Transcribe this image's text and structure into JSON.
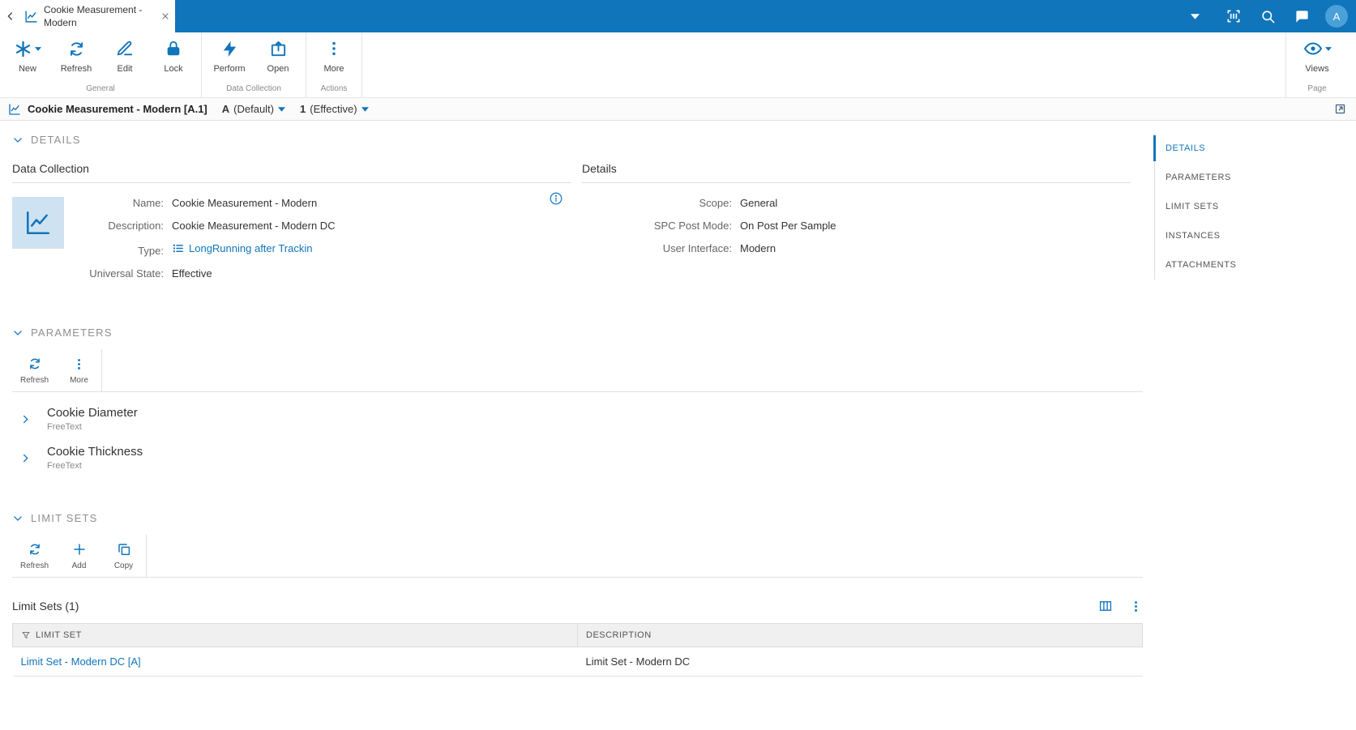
{
  "colors": {
    "accent": "#1075bb",
    "topbar": "#1075bb"
  },
  "topbar": {
    "tab_title": "Cookie Measurement - Modern",
    "avatar": "A"
  },
  "ribbon": {
    "groups": [
      {
        "label": "General",
        "buttons": [
          {
            "label": "New"
          },
          {
            "label": "Refresh"
          },
          {
            "label": "Edit"
          },
          {
            "label": "Lock"
          }
        ]
      },
      {
        "label": "Data Collection",
        "buttons": [
          {
            "label": "Perform"
          },
          {
            "label": "Open"
          }
        ]
      },
      {
        "label": "Actions",
        "buttons": [
          {
            "label": "More"
          }
        ]
      },
      {
        "label": "Page",
        "buttons": [
          {
            "label": "Views"
          }
        ]
      }
    ]
  },
  "breadcrumb": {
    "title": "Cookie Measurement - Modern [A.1]",
    "version": "A",
    "version_label": "(Default)",
    "revision": "1",
    "revision_label": "(Effective)"
  },
  "details": {
    "heading": "DETAILS",
    "data_collection": {
      "title": "Data Collection",
      "fields": [
        {
          "label": "Name:",
          "value": "Cookie Measurement - Modern"
        },
        {
          "label": "Description:",
          "value": "Cookie Measurement - Modern DC"
        },
        {
          "label": "Type:",
          "value": "LongRunning after Trackin"
        },
        {
          "label": "Universal State:",
          "value": "Effective"
        }
      ]
    },
    "panel": {
      "title": "Details",
      "fields": [
        {
          "label": "Scope:",
          "value": "General"
        },
        {
          "label": "SPC Post Mode:",
          "value": "On Post Per Sample"
        },
        {
          "label": "User Interface:",
          "value": "Modern"
        }
      ]
    }
  },
  "parameters": {
    "heading": "PARAMETERS",
    "toolbar": {
      "refresh": "Refresh",
      "more": "More"
    },
    "items": [
      {
        "name": "Cookie Diameter",
        "type": "FreeText"
      },
      {
        "name": "Cookie Thickness",
        "type": "FreeText"
      }
    ]
  },
  "limit_sets": {
    "heading": "LIMIT SETS",
    "toolbar": {
      "refresh": "Refresh",
      "add": "Add",
      "copy": "Copy"
    },
    "table_title": "Limit Sets (1)",
    "columns": [
      "LIMIT SET",
      "DESCRIPTION"
    ],
    "rows": [
      {
        "limit_set": "Limit Set - Modern DC [A]",
        "description": "Limit Set - Modern DC"
      }
    ]
  },
  "nav": {
    "items": [
      {
        "label": "DETAILS"
      },
      {
        "label": "PARAMETERS"
      },
      {
        "label": "LIMIT SETS"
      },
      {
        "label": "INSTANCES"
      },
      {
        "label": "ATTACHMENTS"
      }
    ]
  }
}
